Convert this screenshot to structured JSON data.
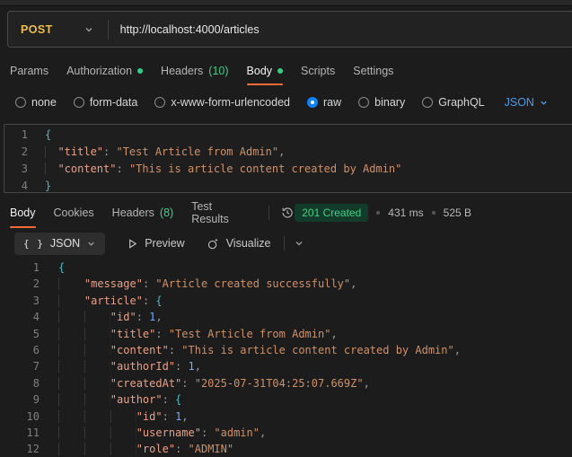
{
  "request": {
    "method": "POST",
    "url": "http://localhost:4000/articles",
    "tabs": [
      {
        "label": "Params"
      },
      {
        "label": "Authorization",
        "dot": true
      },
      {
        "label": "Headers",
        "count": "(10)"
      },
      {
        "label": "Body",
        "dot": true,
        "active": true
      },
      {
        "label": "Scripts"
      },
      {
        "label": "Settings"
      }
    ],
    "body_modes": [
      "none",
      "form-data",
      "x-www-form-urlencoded",
      "raw",
      "binary",
      "GraphQL"
    ],
    "selected_mode": "raw",
    "language": "JSON",
    "editor": {
      "lines": [
        [
          [
            "brace",
            "{"
          ]
        ],
        [
          [
            "ws",
            "  "
          ],
          [
            "key",
            "\"title\""
          ],
          [
            "punct",
            ": "
          ],
          [
            "string",
            "\"Test Article from Admin\""
          ],
          [
            "punct",
            ","
          ]
        ],
        [
          [
            "ws",
            "  "
          ],
          [
            "key",
            "\"content\""
          ],
          [
            "punct",
            ": "
          ],
          [
            "string",
            "\"This is article content created by Admin\""
          ]
        ],
        [
          [
            "brace",
            "}"
          ]
        ]
      ]
    }
  },
  "response": {
    "tabs": [
      {
        "label": "Body",
        "active": true
      },
      {
        "label": "Cookies"
      },
      {
        "label": "Headers",
        "count": "(8)"
      },
      {
        "label": "Test Results"
      }
    ],
    "status": "201 Created",
    "time": "431 ms",
    "size": "525 B",
    "toolbar": {
      "format_icon": "{ }",
      "format_label": "JSON",
      "preview_label": "Preview",
      "visualize_label": "Visualize"
    },
    "editor": {
      "lines": [
        [
          [
            "brace",
            "{"
          ]
        ],
        [
          [
            "ws",
            "    "
          ],
          [
            "key",
            "\"message\""
          ],
          [
            "punct",
            ": "
          ],
          [
            "string",
            "\"Article created successfully\""
          ],
          [
            "punct",
            ","
          ]
        ],
        [
          [
            "ws",
            "    "
          ],
          [
            "key",
            "\"article\""
          ],
          [
            "punct",
            ": "
          ],
          [
            "brace",
            "{"
          ]
        ],
        [
          [
            "ws",
            "        "
          ],
          [
            "key",
            "\"id\""
          ],
          [
            "punct",
            ": "
          ],
          [
            "number",
            "1"
          ],
          [
            "punct",
            ","
          ]
        ],
        [
          [
            "ws",
            "        "
          ],
          [
            "key",
            "\"title\""
          ],
          [
            "punct",
            ": "
          ],
          [
            "string",
            "\"Test Article from Admin\""
          ],
          [
            "punct",
            ","
          ]
        ],
        [
          [
            "ws",
            "        "
          ],
          [
            "key",
            "\"content\""
          ],
          [
            "punct",
            ": "
          ],
          [
            "string",
            "\"This is article content created by Admin\""
          ],
          [
            "punct",
            ","
          ]
        ],
        [
          [
            "ws",
            "        "
          ],
          [
            "key",
            "\"authorId\""
          ],
          [
            "punct",
            ": "
          ],
          [
            "number",
            "1"
          ],
          [
            "punct",
            ","
          ]
        ],
        [
          [
            "ws",
            "        "
          ],
          [
            "key",
            "\"createdAt\""
          ],
          [
            "punct",
            ": "
          ],
          [
            "string",
            "\"2025-07-31T04:25:07.669Z\""
          ],
          [
            "punct",
            ","
          ]
        ],
        [
          [
            "ws",
            "        "
          ],
          [
            "key",
            "\"author\""
          ],
          [
            "punct",
            ": "
          ],
          [
            "brace",
            "{"
          ]
        ],
        [
          [
            "ws",
            "            "
          ],
          [
            "key",
            "\"id\""
          ],
          [
            "punct",
            ": "
          ],
          [
            "number",
            "1"
          ],
          [
            "punct",
            ","
          ]
        ],
        [
          [
            "ws",
            "            "
          ],
          [
            "key",
            "\"username\""
          ],
          [
            "punct",
            ": "
          ],
          [
            "string",
            "\"admin\""
          ],
          [
            "punct",
            ","
          ]
        ],
        [
          [
            "ws",
            "            "
          ],
          [
            "key",
            "\"role\""
          ],
          [
            "punct",
            ": "
          ],
          [
            "string",
            "\"ADMIN\""
          ]
        ]
      ]
    }
  },
  "colors": {
    "accent_orange": "#ff6c37",
    "method_post_yellow": "#edbe4c",
    "success_green": "#3fd184",
    "radio_blue": "#0d82ff",
    "link_blue": "#4c9be8"
  }
}
